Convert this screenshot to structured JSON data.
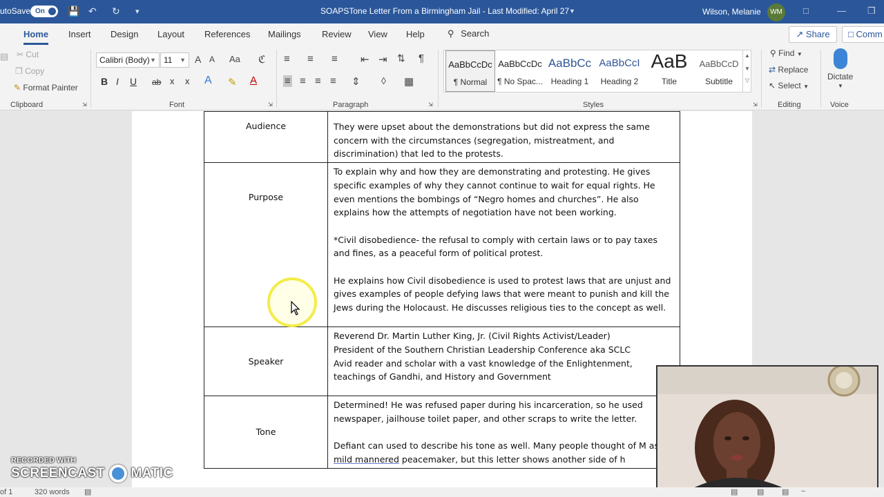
{
  "titlebar": {
    "autosave_label": "utoSave",
    "autosave_state": "On",
    "document_title": "SOAPSTone Letter From a Birmingham Jail  -  Last Modified: April 27",
    "user_name": "Wilson, Melanie",
    "user_initials": "WM"
  },
  "tabs": {
    "items": [
      "Home",
      "Insert",
      "Design",
      "Layout",
      "References",
      "Mailings",
      "Review",
      "View",
      "Help"
    ],
    "search_label": "Search",
    "share_label": "Share",
    "comments_label": "Comm"
  },
  "ribbon": {
    "clipboard": {
      "cut": "Cut",
      "copy": "Copy",
      "format_painter": "Format Painter",
      "label": "Clipboard"
    },
    "font": {
      "font_name": "Calibri (Body)",
      "font_size": "11",
      "grow": "A",
      "shrink": "A",
      "change_case": "Aa",
      "bold": "B",
      "italic": "I",
      "underline": "U",
      "strikethrough": "ab",
      "subscript": "x",
      "superscript": "x",
      "text_effects": "A",
      "font_color": "A",
      "label": "Font"
    },
    "paragraph": {
      "label": "Paragraph"
    },
    "styles": {
      "items": [
        {
          "preview": "AaBbCcDc",
          "name": "¶ Normal"
        },
        {
          "preview": "AaBbCcDc",
          "name": "¶ No Spac..."
        },
        {
          "preview": "AaBbCc",
          "name": "Heading 1"
        },
        {
          "preview": "AaBbCcI",
          "name": "Heading 2"
        },
        {
          "preview": "AaB",
          "name": "Title"
        },
        {
          "preview": "AaBbCcD",
          "name": "Subtitle"
        }
      ],
      "label": "Styles"
    },
    "editing": {
      "find": "Find",
      "replace": "Replace",
      "select": "Select",
      "label": "Editing"
    },
    "voice": {
      "dictate": "Dictate",
      "label": "Voice"
    }
  },
  "document": {
    "rows": [
      {
        "label": "Audience",
        "paragraphs": [
          "They were upset about the demonstrations but did not express the same concern with the circumstances (segregation, mistreatment, and discrimination) that led to the protests."
        ]
      },
      {
        "label": "Purpose",
        "paragraphs": [
          "To explain why and how they are demonstrating and protesting. He gives specific examples of why they cannot continue to wait for equal rights. He even mentions the bombings of “Negro homes and churches”. He also explains how the attempts of negotiation have not been working.",
          "*Civil disobedience- the refusal to comply with certain laws or to pay taxes and fines, as a peaceful form of political protest.",
          "He explains how Civil disobedience is used to protest laws that are unjust and gives examples of people defying laws that were meant to punish and kill the Jews during the Holocaust. He discusses religious ties to the concept as well."
        ]
      },
      {
        "label": "Speaker",
        "lines": [
          "Reverend Dr. Martin Luther King, Jr. (Civil Rights Activist/Leader)",
          "President of the Southern Christian Leadership Conference aka SCLC",
          "Avid reader and scholar with a vast knowledge of the Enlightenment, teachings of Gandhi, and History and Government"
        ]
      },
      {
        "label": "Tone",
        "p1": "Determined! He was refused paper during his incarceration, so he used newspaper, jailhouse toilet paper, and other scraps to write the letter.",
        "p2_before": "Defiant can used to describe his tone as well. Many people thought of M as a ",
        "p2_underlined": "mild mannered",
        "p2_after": " peacemaker, but this letter shows another side of h"
      }
    ]
  },
  "watermark": {
    "line1": "RECORDED WITH",
    "line2a": "SCREENCAST",
    "line2b": "MATIC"
  },
  "statusbar": {
    "page": "of 1",
    "words": "320 words"
  }
}
